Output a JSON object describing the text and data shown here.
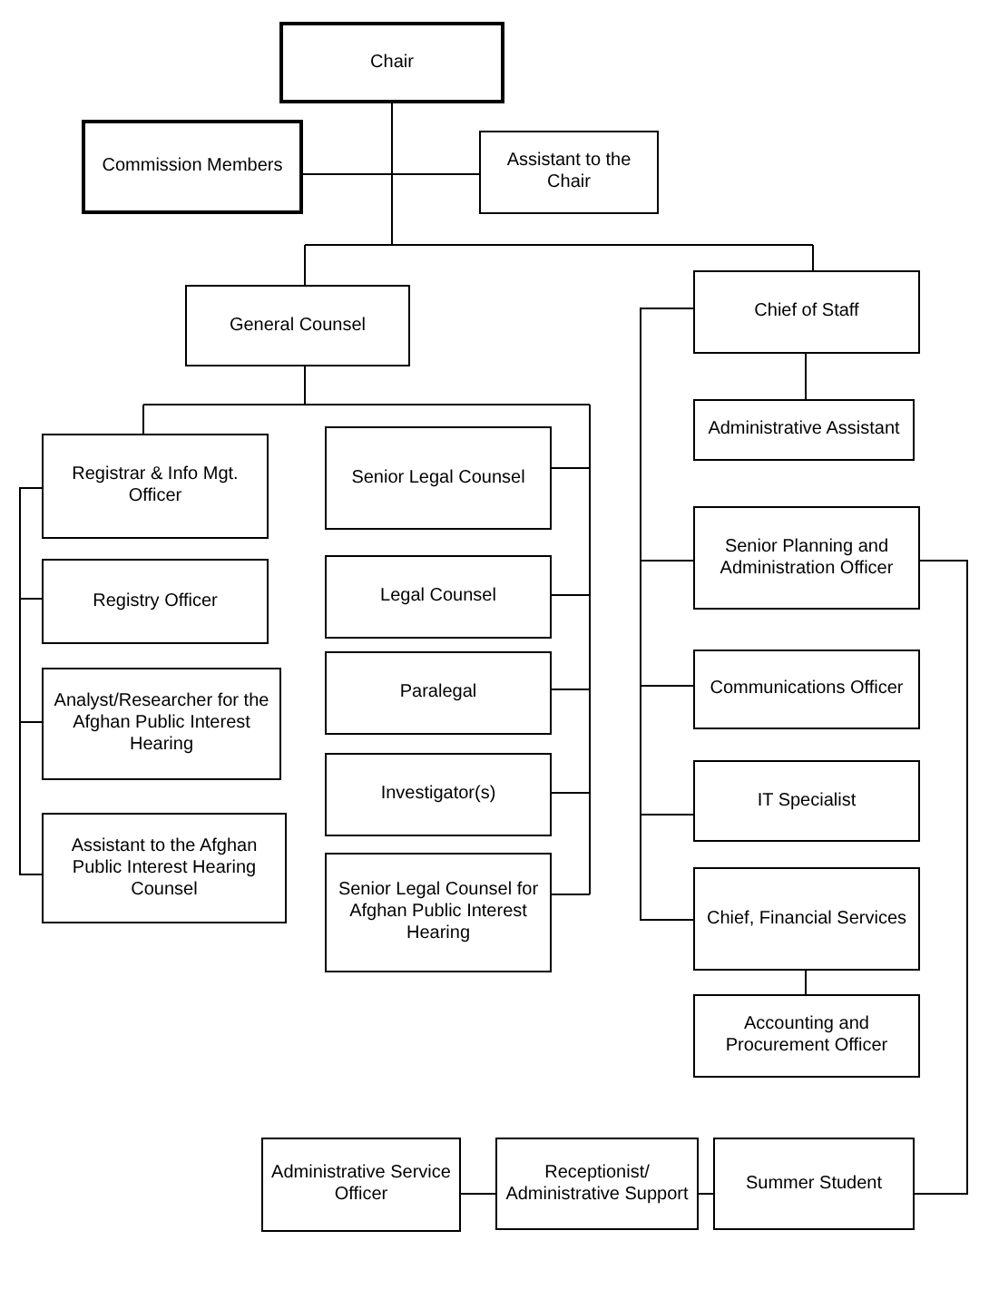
{
  "nodes": [
    {
      "label": "Chair",
      "emphasized": true
    },
    {
      "label": "Commission Members",
      "emphasized": true
    },
    {
      "label": "Assistant to the Chair",
      "emphasized": false
    },
    {
      "label": "General Counsel",
      "emphasized": false
    },
    {
      "label": "Chief of Staff",
      "emphasized": false
    },
    {
      "label": "Administrative Assistant",
      "emphasized": false
    },
    {
      "label": "Registrar & Info Mgt. Officer",
      "emphasized": false
    },
    {
      "label": "Registry Officer",
      "emphasized": false
    },
    {
      "label": "Analyst/Researcher for the Afghan Public Interest Hearing",
      "emphasized": false
    },
    {
      "label": "Assistant to the Afghan Public Interest Hearing Counsel",
      "emphasized": false
    },
    {
      "label": "Senior Legal Counsel",
      "emphasized": false
    },
    {
      "label": "Legal Counsel",
      "emphasized": false
    },
    {
      "label": "Paralegal",
      "emphasized": false
    },
    {
      "label": "Investigator(s)",
      "emphasized": false
    },
    {
      "label": "Senior Legal Counsel for Afghan Public Interest Hearing",
      "emphasized": false
    },
    {
      "label": "Senior Planning and Administration Officer",
      "emphasized": false
    },
    {
      "label": "Communications Officer",
      "emphasized": false
    },
    {
      "label": "IT Specialist",
      "emphasized": false
    },
    {
      "label": "Chief, Financial Services",
      "emphasized": false
    },
    {
      "label": "Accounting and Procurement Officer",
      "emphasized": false
    },
    {
      "label": "Administrative Service Officer",
      "emphasized": false
    },
    {
      "label": "Receptionist/ Administrative Support",
      "emphasized": false
    },
    {
      "label": "Summer Student",
      "emphasized": false
    }
  ]
}
